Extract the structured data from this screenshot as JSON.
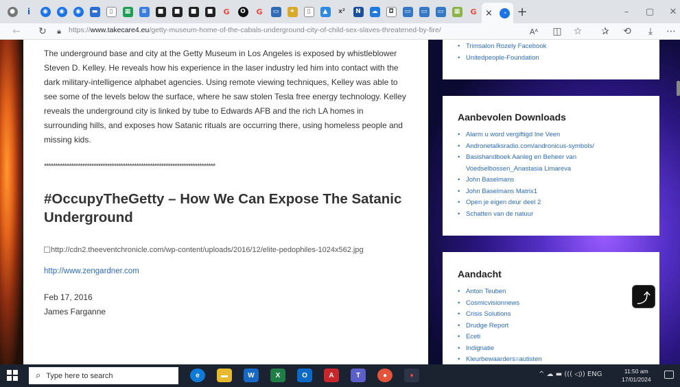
{
  "browser": {
    "tabs_icons": [
      "person-icon",
      "info-icon",
      "chrome-icon",
      "chrome-icon",
      "chrome-icon",
      "message-icon",
      "page-icon",
      "sheets-icon",
      "docs-icon",
      "video-icon",
      "video-icon",
      "video-icon",
      "video-icon",
      "google-icon",
      "opera-icon",
      "google-icon",
      "window-icon",
      "puzzle-icon",
      "page-icon",
      "arrow-icon",
      "chart-icon",
      "notion-icon",
      "cloud-icon",
      "cloud-icon",
      "image-icon",
      "window-icon",
      "window-icon",
      "window-icon",
      "sheets-icon",
      "google-icon"
    ],
    "active_tab_close": "×",
    "new_tab": "+",
    "url_prefix": "https://",
    "url_domain": "www.takecare4.eu",
    "url_path": "/getty-museum-home-of-the-cabals-underground-city-of-child-sex-slaves-threatened-by-fire/"
  },
  "article": {
    "paragraph": "The underground base and city at the Getty Museum in Los Angeles is exposed by whistleblower Steven D. Kelley. He reveals how his experience in the laser industry led him into contact with the dark military-intelligence alphabet agencies. Using remote viewing techniques, Kelley was able to see some of the levels below the surface, where he saw stolen Tesla free energy technology. Kelley reveals the underground city is linked by tube to Edwards AFB and the rich LA homes in surrounding hills, and exposes how Satanic rituals are occurring there, using homeless people and missing kids.",
    "separator": "****************************************************************************",
    "heading": "#OccupyTheGetty – How We Can Expose The Satanic Underground",
    "image_alt": "http://cdn2.theeventchronicle.com/wp-content/uploads/2016/12/elite-pedophiles-1024x562.jpg",
    "link": "http://www.zengardner.com",
    "date": "Feb 17, 2016",
    "author": "James Farganne"
  },
  "sidebar": {
    "top_widget_items": [
      "Trimsalon Rozely Facebook",
      "Unitedpeople-Foundation"
    ],
    "downloads": {
      "title": "Aanbevolen Downloads",
      "items": [
        "Alarm u word vergiftigd Ine Veen",
        "Andronetalksradio.com/andronicus-symbols/",
        "Basishandboek Aanleg en Beheer van Voedselbossen_Anastasia Limareva",
        "John Baselmans",
        "John Baselmans Matrix1",
        "Open je eigen deur deel 2",
        "Schatten van de natuur"
      ]
    },
    "aandacht": {
      "title": "Aandacht",
      "items": [
        "Anton Teuben",
        "Cosmicvisionnews",
        "Crisis Solutions",
        "Drudge Report",
        "Eceti",
        "Indignatie",
        "Kleurbewaarders=autisten"
      ]
    }
  },
  "taskbar": {
    "search_placeholder": "Type here to search",
    "tray_text": "^ ☁ ▬ ((( ◁)) ENG",
    "time": "11:50 am",
    "date": "17/01/2024"
  },
  "colors": {
    "link": "#2a6bc8",
    "taskbar": "#1c2330"
  }
}
